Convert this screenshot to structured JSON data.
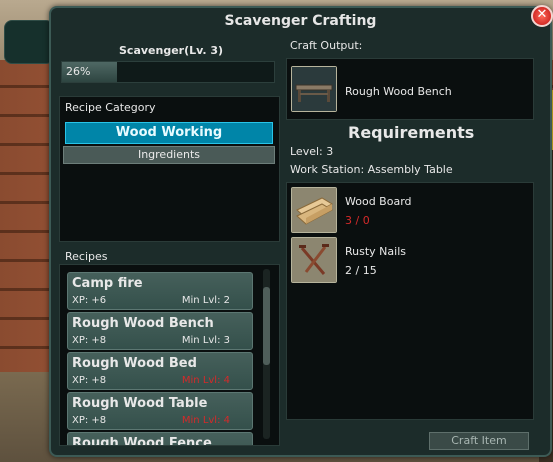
{
  "window": {
    "title": "Scavenger Crafting",
    "close_symbol": "✕"
  },
  "skill": {
    "name": "Scavenger(Lv. 3)",
    "progress_text": "26%",
    "progress_fraction": 0.26
  },
  "category": {
    "label": "Recipe Category",
    "items": [
      "Wood Working",
      "Ingredients"
    ],
    "selected": "Wood Working"
  },
  "recipes": {
    "label": "Recipes",
    "items": [
      {
        "name": "Camp fire",
        "xp": "XP: +6",
        "min_lvl": "Min Lvl: 2",
        "lvl_ok": true
      },
      {
        "name": "Rough Wood Bench",
        "xp": "XP: +8",
        "min_lvl": "Min Lvl: 3",
        "lvl_ok": true
      },
      {
        "name": "Rough Wood Bed",
        "xp": "XP: +8",
        "min_lvl": "Min Lvl: 4",
        "lvl_ok": false
      },
      {
        "name": "Rough Wood Table",
        "xp": "XP: +8",
        "min_lvl": "Min Lvl: 4",
        "lvl_ok": false
      },
      {
        "name": "Rough Wood Fence",
        "xp": "",
        "min_lvl": "",
        "lvl_ok": true
      }
    ]
  },
  "output": {
    "label": "Craft Output:",
    "item_name": "Rough Wood Bench",
    "icon": "bench-icon"
  },
  "requirements": {
    "title": "Requirements",
    "level": "Level: 3",
    "station": "Work Station: Assembly Table",
    "items": [
      {
        "name": "Wood Board",
        "count": "3 / 0",
        "enough": false,
        "icon": "wood-board-icon"
      },
      {
        "name": "Rusty Nails",
        "count": "2 / 15",
        "enough": true,
        "icon": "rusty-nails-icon"
      }
    ]
  },
  "actions": {
    "craft_label": "Craft Item"
  },
  "colors": {
    "accent": "#0085a8",
    "insufficient": "#d42a2a",
    "panel": "#1c2c2a"
  }
}
